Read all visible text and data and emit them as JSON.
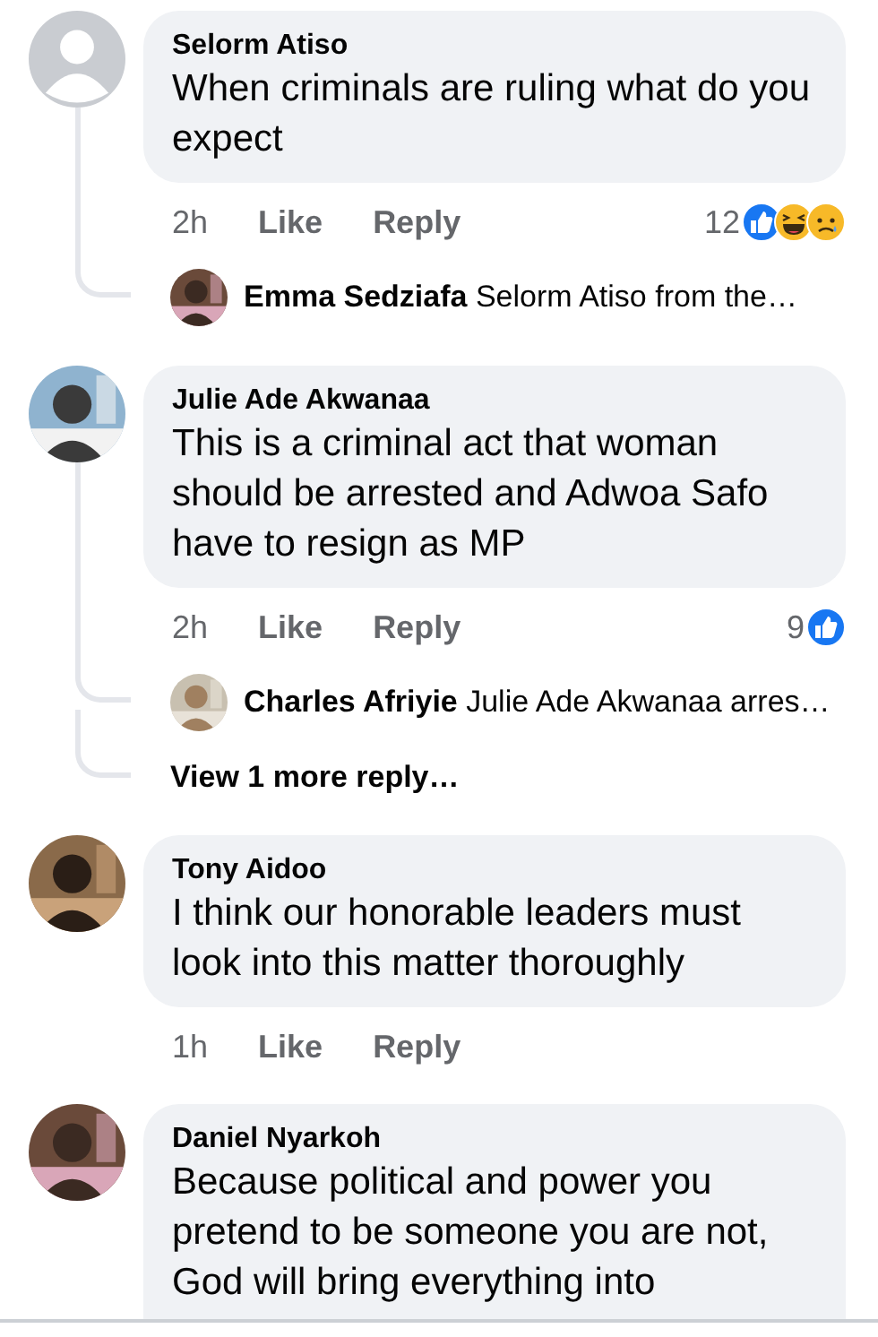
{
  "comments": [
    {
      "author": "Selorm Atiso",
      "avatar": {
        "kind": "default"
      },
      "text": "When criminals are ruling what do you expect",
      "time": "2h",
      "like": "Like",
      "reply": "Reply",
      "reaction_count": "12",
      "reactions": [
        {
          "kind": "like"
        },
        {
          "kind": "haha"
        },
        {
          "kind": "sad"
        }
      ],
      "replies": [
        {
          "author": "Emma Sedziafa",
          "text": "Selorm Atiso from the…"
        }
      ]
    },
    {
      "author": "Julie Ade Akwanaa",
      "text": "This is a criminal act that woman should be arrested and Adwoa Safo have to resign as MP",
      "time": "2h",
      "like": "Like",
      "reply": "Reply",
      "reaction_count": "9",
      "reactions": [
        {
          "kind": "like"
        }
      ],
      "replies": [
        {
          "author": "Charles Afriyie",
          "text": "Julie Ade Akwanaa arres…"
        }
      ],
      "more_replies": "View 1 more reply…"
    },
    {
      "author": "Tony Aidoo",
      "text": "I think our honorable leaders must look into this matter thoroughly",
      "time": "1h",
      "like": "Like",
      "reply": "Reply"
    },
    {
      "author": "Daniel Nyarkoh",
      "text": "Because political and power you pretend to be someone you are not, God will bring everything into"
    }
  ]
}
